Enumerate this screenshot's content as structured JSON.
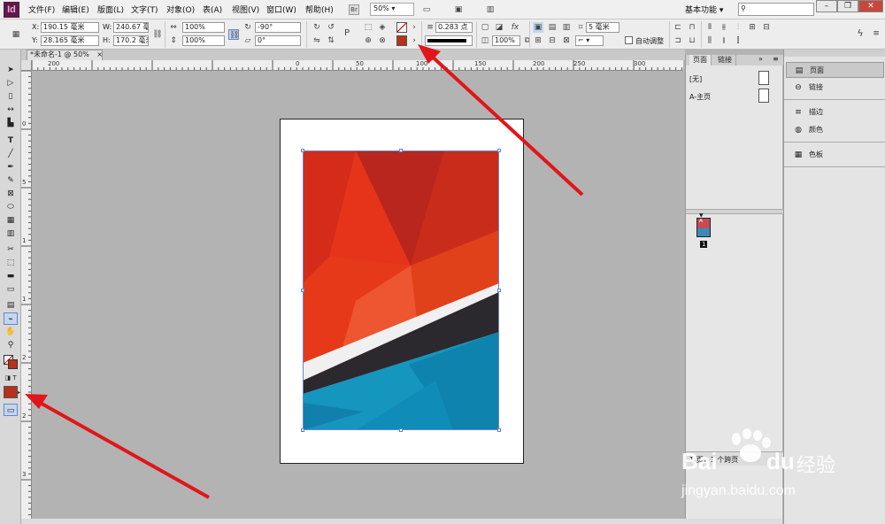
{
  "app": {
    "logo": "Id"
  },
  "menubar": {
    "items": [
      "文件(F)",
      "编辑(E)",
      "版面(L)",
      "文字(T)",
      "对象(O)",
      "表(A)",
      "视图(V)",
      "窗口(W)",
      "帮助(H)"
    ],
    "zoom": "50%",
    "workspace": "基本功能",
    "search_placeholder": "",
    "win_minimize": "–",
    "win_restore": "❐",
    "win_close": "✕"
  },
  "control": {
    "x_label": "X:",
    "x_value": "190.15 毫米",
    "y_label": "Y:",
    "y_value": "28.165 毫米",
    "w_label": "W:",
    "w_value": "240.67 毫米",
    "h_label": "H:",
    "h_value": "170.2 毫米",
    "scale_x": "100%",
    "scale_y": "100%",
    "rotate": "-90°",
    "shear": "0°",
    "stroke_weight": "0.283 点",
    "opacity": "100%",
    "frame_size": "5 毫米",
    "auto_fit": "自动调整"
  },
  "document": {
    "tab_label": "*未命名-1 @ 50%",
    "tab_close": "×"
  },
  "rulers": {
    "h_ticks": [
      "200",
      "0",
      "50",
      "100",
      "150",
      "200",
      "250",
      "300"
    ],
    "v_ticks": [
      "0",
      "5",
      "1",
      "1",
      "2",
      "2",
      "3"
    ]
  },
  "pages_panel": {
    "tab_pages": "页面",
    "tab_links": "链接",
    "none_label": "[无]",
    "master_label": "A-主页",
    "thumb_label": "A",
    "page_number": "1",
    "footer_text": "1 页，1 个跨页"
  },
  "dock": {
    "items": [
      {
        "label": "页面",
        "icon": "▤"
      },
      {
        "label": "链接",
        "icon": "⊖"
      },
      {
        "label": "描边",
        "icon": "≡"
      },
      {
        "label": "颜色",
        "icon": "◍"
      },
      {
        "label": "色板",
        "icon": "▦"
      }
    ]
  },
  "watermark": {
    "brand": "Bai",
    "brand2": "du",
    "suffix": "经验",
    "url": "jingyan.baidu.com"
  },
  "colors": {
    "accent": "#5b1a47",
    "fill_swatch": "#b5331a",
    "arrow": "#e0161b"
  }
}
